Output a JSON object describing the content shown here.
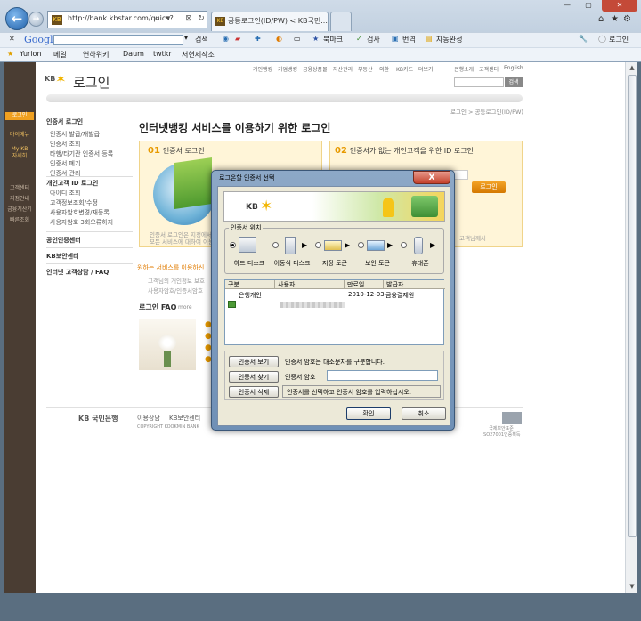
{
  "browser": {
    "address": "http://bank.kbstar.com/quics?...",
    "favicon_label": "KB",
    "tabs": [
      {
        "label": "공동로그인(ID/PW) < KB국민..."
      },
      {
        "label": ""
      }
    ],
    "google_label": "Google",
    "toolbar": {
      "search_label": "검색",
      "bookmark_label": "북마크",
      "check_label": "검사",
      "translate_label": "번역",
      "autofill_label": "자동완성",
      "login_label": "로그인"
    },
    "favorites": [
      {
        "label": "Yurion"
      },
      {
        "label": "메일"
      },
      {
        "label": "연하위키"
      },
      {
        "label": "Daum"
      },
      {
        "label": "twtkr"
      },
      {
        "label": "서현제작소"
      }
    ]
  },
  "page": {
    "top_nav": [
      "개인뱅킹",
      "기업뱅킹",
      "금융상품몰",
      "자산관리",
      "부동산",
      "외환",
      "KB카드",
      "더보기",
      "은행소개",
      "고객센터",
      "English"
    ],
    "logo": "KB",
    "title": "로그인",
    "search_button": "검색",
    "breadcrumb": "로그인 > 공동로그인(ID/PW)",
    "sidebar": [
      {
        "label": "로그인"
      },
      {
        "label": "마이메뉴"
      },
      {
        "label": "My KB 자세히"
      },
      {
        "label": "고객센터"
      },
      {
        "label": "지점안내"
      },
      {
        "label": "금융계산기"
      },
      {
        "label": "빠른조회"
      }
    ],
    "left_menu": {
      "cert_header": "인증서 로그인",
      "cert_items": [
        "인증서 발급/재발급",
        "인증서 조회",
        "타행/타기관 인증서 등록",
        "인증서 폐기",
        "인증서 관리"
      ],
      "id_header": "개인고객 ID 로그인",
      "id_items": [
        "아이디 조회",
        "고객정보조회/수정",
        "사용자암호변경/재등록",
        "사용자암호 3회오류하지"
      ],
      "sections": [
        "공인인증센터",
        "KB보안센터",
        "인터넷 고객상담 / FAQ"
      ]
    },
    "main_title": "인터넷뱅킹 서비스를 이용하기 위한 로그인",
    "section1": {
      "num": "01",
      "title": "인증서 로그인"
    },
    "section2": {
      "num": "02",
      "title": "인증서가 없는 개인고객을 위한 ID 로그인"
    },
    "id_login_button": "로그인",
    "faint_lines": [
      "인증서 로그인은 지정에서",
      "모든 서비스에 대하여 이용"
    ],
    "faint_right": "고객님께서",
    "notice_title": "원하는 서비스를 이용하신",
    "notice_items": [
      "고객님의 개인정보 보호",
      "사용자암호/인증서암호"
    ],
    "faq_title": "로그인 FAQ",
    "faq_more": "more",
    "footer": {
      "brand": "KB 국민은행",
      "links": [
        "이용상담",
        "KB보안센터"
      ],
      "copyright": "COPYRIGHT KOOKMIN BANK",
      "cert_mark": "국제보안표준 ISO27001인증획득"
    }
  },
  "dialog": {
    "title": "로그온할 인증서 선택",
    "close": "X",
    "banner_logo": "KB",
    "location_group": "인증서 위치",
    "locations": [
      {
        "label": "하드 디스크",
        "selected": true
      },
      {
        "label": "이동식 디스크",
        "selected": false
      },
      {
        "label": "저장 토큰",
        "selected": false
      },
      {
        "label": "보안 토큰",
        "selected": false
      },
      {
        "label": "휴대폰",
        "selected": false
      }
    ],
    "columns": [
      "구분",
      "사용자",
      "만료일",
      "발급자"
    ],
    "rows": [
      {
        "type": "은행개인",
        "user": "",
        "expiry": "2010-12-03",
        "issuer": "금융결제원"
      }
    ],
    "buttons": {
      "view": "인증서 보기",
      "find": "인증서 찾기",
      "delete": "인증서 삭제",
      "ok": "확인",
      "cancel": "취소"
    },
    "case_note": "인증서 암호는 대소문자를 구분합니다.",
    "password_label": "인증서 암호",
    "instruction": "인증서를 선택하고 인증서 암호를 입력하십시오."
  }
}
